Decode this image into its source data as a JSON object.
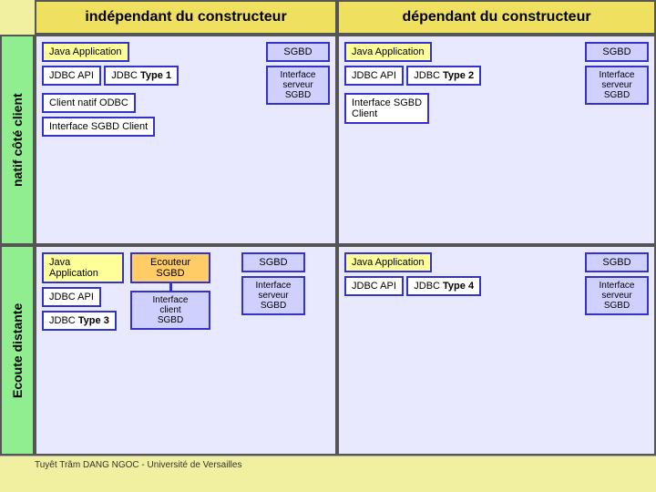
{
  "header": {
    "independent_label": "indépendant du constructeur",
    "dependent_label": "dépendant du constructeur"
  },
  "sidebar": {
    "top_label": "natif côté client",
    "bottom_label": "Ecoute distante"
  },
  "top_left_cell": {
    "java_app": "Java Application",
    "jdbc_api": "JDBC API",
    "jdbc_type": "JDBC Type 1",
    "client_natif": "Client natif ODBC",
    "interface_sgbd_client": "Interface SGBD Client",
    "sgbd": "SGBD",
    "interface_serveur": "Interface serveur SGBD"
  },
  "top_right_cell": {
    "java_app": "Java Application",
    "jdbc_api": "JDBC API",
    "jdbc_type": "JDBC Type 2",
    "interface_sgbd_client": "Interface SGBD Client",
    "sgbd": "SGBD",
    "interface_serveur": "Interface serveur SGBD"
  },
  "bottom_left_cell": {
    "java_app": "Java Application",
    "jdbc_api": "JDBC API",
    "jdbc_type": "JDBC Type 3",
    "ecouteur_sgbd": "Ecouteur SGBD",
    "interface_client": "Interface client SGBD",
    "sgbd": "SGBD",
    "interface_serveur": "Interface serveur SGBD"
  },
  "bottom_right_cell": {
    "java_app": "Java Application",
    "jdbc_api": "JDBC API",
    "jdbc_type": "JDBC Type 4",
    "sgbd": "SGBD",
    "interface_serveur": "Interface serveur SGBD"
  },
  "footer": {
    "text": "Tuyêt Trâm DANG NGOC - Université de Versailles"
  }
}
